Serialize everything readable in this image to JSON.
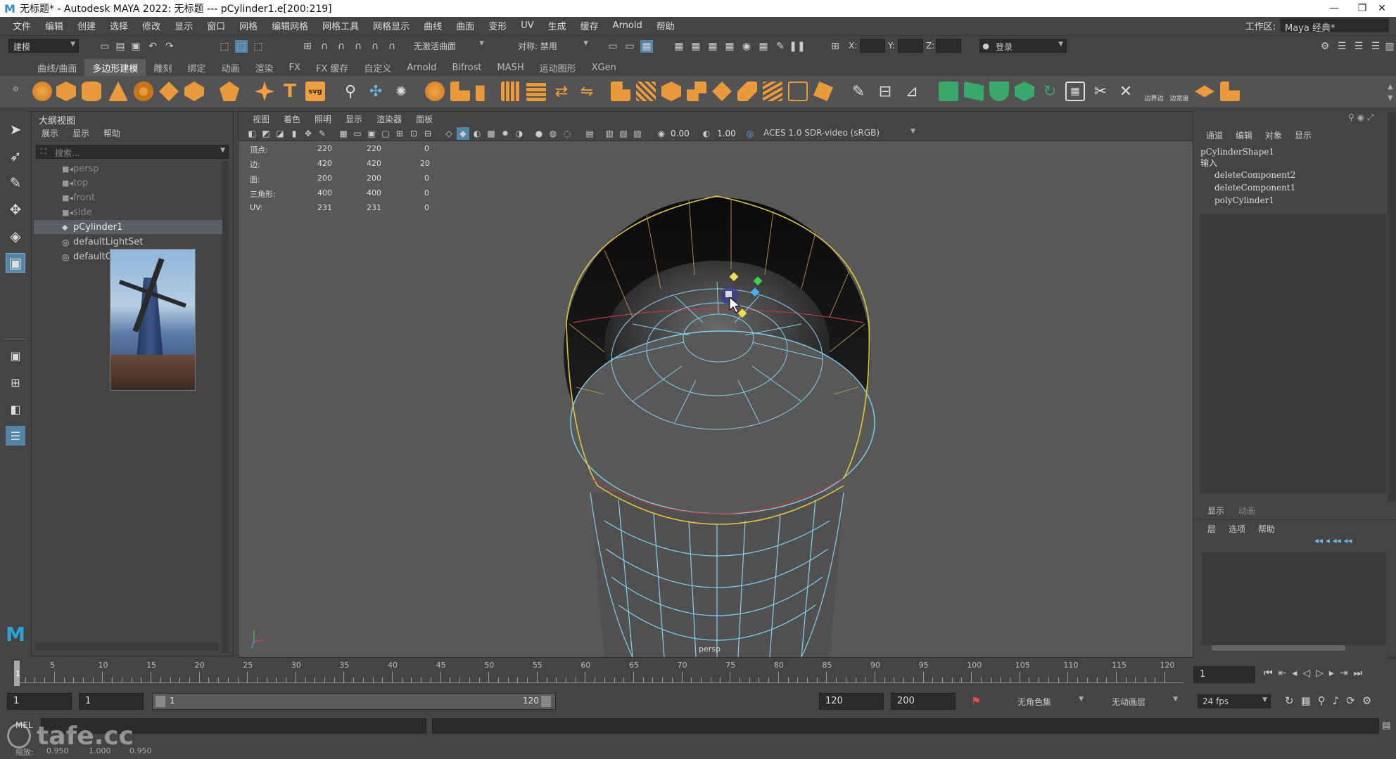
{
  "titlebar": {
    "title": "无标题* - Autodesk MAYA 2022: 无标题   ---   pCylinder1.e[200:219]",
    "minimize": "—",
    "maximize": "❐",
    "close": "✕"
  },
  "menubar": {
    "items": [
      "文件",
      "编辑",
      "创建",
      "选择",
      "修改",
      "显示",
      "窗口",
      "网格",
      "编辑网格",
      "网格工具",
      "网格显示",
      "曲线",
      "曲面",
      "变形",
      "UV",
      "生成",
      "缓存",
      "Arnold",
      "帮助"
    ],
    "workspace_label": "工作区:",
    "workspace_value": "Maya 经典*"
  },
  "statusline": {
    "menu_set": "建模",
    "live_surface": "无激活曲面",
    "symmetry": "对称: 禁用",
    "x_label": "X:",
    "y_label": "Y:",
    "z_label": "Z:",
    "login": "登录"
  },
  "shelf": {
    "tabs": [
      "曲线/曲面",
      "多边形建模",
      "雕刻",
      "绑定",
      "动画",
      "渲染",
      "FX",
      "FX 缓存",
      "自定义",
      "Arnold",
      "Bifrost",
      "MASH",
      "运动图形",
      "XGen"
    ],
    "active_tab": "多边形建模",
    "text_icon_1": "边界边",
    "text_icon_2": "边宽度"
  },
  "outliner": {
    "title": "大纲视图",
    "menus": [
      "展示",
      "显示",
      "帮助"
    ],
    "search_placeholder": "搜索...",
    "items": [
      "persp",
      "top",
      "front",
      "side",
      "pCylinder1",
      "defaultLightSet",
      "defaultObjectSet"
    ],
    "selected": "pCylinder1"
  },
  "viewport": {
    "menus": [
      "视图",
      "着色",
      "照明",
      "显示",
      "渲染器",
      "面板"
    ],
    "near_clip": "0.00",
    "far_value": "1.00",
    "colorspace": "ACES 1.0 SDR-video (sRGB)",
    "camera_label": "persp",
    "hud": {
      "rows": [
        {
          "label": "顶点:",
          "a": "220",
          "b": "220",
          "c": "0"
        },
        {
          "label": "边:",
          "a": "420",
          "b": "420",
          "c": "20"
        },
        {
          "label": "面:",
          "a": "200",
          "b": "200",
          "c": "0"
        },
        {
          "label": "三角形:",
          "a": "400",
          "b": "400",
          "c": "0"
        },
        {
          "label": "UV:",
          "a": "231",
          "b": "231",
          "c": "0"
        }
      ]
    }
  },
  "channelbox": {
    "menus": [
      "通道",
      "编辑",
      "对象",
      "显示"
    ],
    "shape": "pCylinderShape1",
    "inputs_label": "输入",
    "inputs": [
      "deleteComponent2",
      "deleteComponent1",
      "polyCylinder1"
    ]
  },
  "layers": {
    "tabs": [
      "显示",
      "动画"
    ],
    "menus": [
      "层",
      "选项",
      "帮助"
    ]
  },
  "timeline": {
    "ticks": [
      "5",
      "10",
      "15",
      "20",
      "25",
      "30",
      "35",
      "40",
      "45",
      "50",
      "55",
      "60",
      "65",
      "70",
      "75",
      "80",
      "85",
      "90",
      "95",
      "100",
      "105",
      "110",
      "115",
      "120"
    ],
    "current_frame": "1",
    "current_field": "1"
  },
  "range": {
    "start": "1",
    "start2": "1",
    "slider_start": "1",
    "slider_end": "120",
    "end": "120",
    "end2": "200",
    "character_set": "无角色集",
    "anim_layer": "无动画层",
    "fps": "24 fps"
  },
  "commandline": {
    "lang": "MEL"
  },
  "helpline": {
    "text": "缩放:",
    "v1": "0.950",
    "v2": "1.000",
    "v3": "0.950"
  },
  "watermark": "tafe.cc"
}
